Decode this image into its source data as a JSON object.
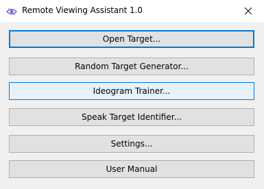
{
  "window": {
    "title": "Remote Viewing Assistant 1.0",
    "app_icon": "eye-icon",
    "close_icon": "close-icon"
  },
  "buttons": [
    {
      "label": "Open Target...",
      "state": "default"
    },
    {
      "label": "Random Target Generator...",
      "state": "normal"
    },
    {
      "label": "Ideogram Trainer...",
      "state": "hover"
    },
    {
      "label": "Speak Target Identifier...",
      "state": "normal"
    },
    {
      "label": "Settings...",
      "state": "normal"
    },
    {
      "label": "User Manual",
      "state": "normal"
    }
  ],
  "colors": {
    "accent": "#0078d7",
    "button_face": "#e1e1e1",
    "button_hover": "#e5f1fb",
    "window_bg": "#f0f0f0",
    "icon_purple": "#6a5acd"
  }
}
